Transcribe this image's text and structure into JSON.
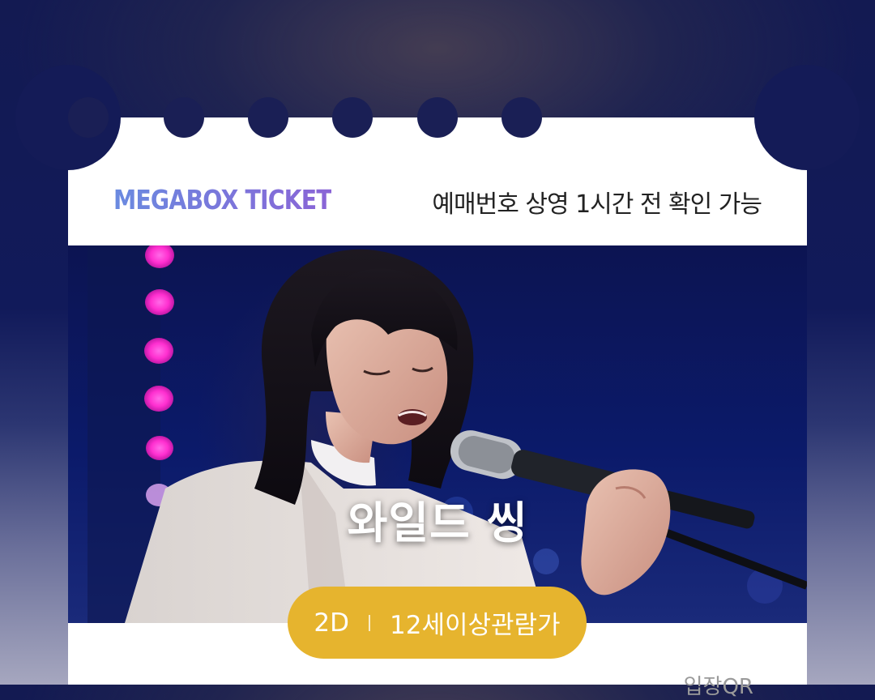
{
  "ticket": {
    "brand_label": "MEGABOX TICKET",
    "booking_note": "예매번호 상영 1시간 전 확인 가능"
  },
  "movie": {
    "title": "와일드 씽",
    "format": "2D",
    "rating": "12세이상관람가"
  },
  "footer": {
    "qr_label": "입장QR"
  },
  "colors": {
    "page_bg_top": "#131a52",
    "ticket_bg": "#ffffff",
    "badge_bg": "#e6b42e",
    "brand_gradient_start": "#6a8ae0",
    "brand_gradient_end": "#8a64d6",
    "stage_light": "#ff3dd2"
  }
}
